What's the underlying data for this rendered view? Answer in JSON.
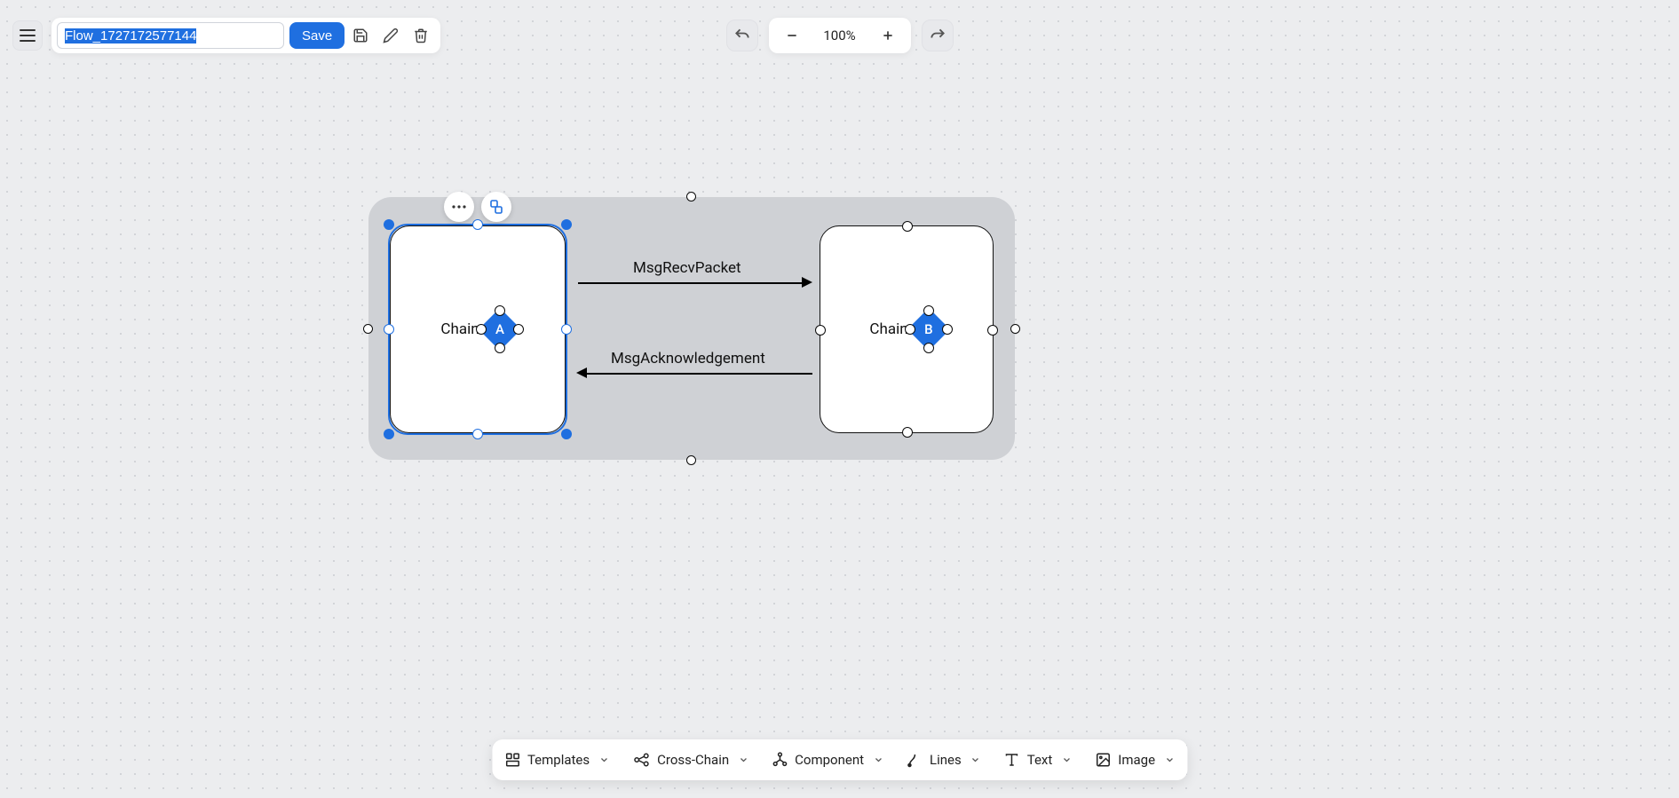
{
  "header": {
    "filename": "Flow_1727172577144",
    "save_label": "Save"
  },
  "zoom": {
    "percent": "100%"
  },
  "diagram": {
    "chain_a_prefix": "Chain",
    "chain_a_badge": "A",
    "chain_b_prefix": "Chain",
    "chain_b_badge": "B",
    "arrow_top_label": "MsgRecvPacket",
    "arrow_bottom_label": "MsgAcknowledgement"
  },
  "bottom_toolbar": {
    "templates": "Templates",
    "cross_chain": "Cross-Chain",
    "component": "Component",
    "lines": "Lines",
    "text": "Text",
    "image": "Image"
  }
}
